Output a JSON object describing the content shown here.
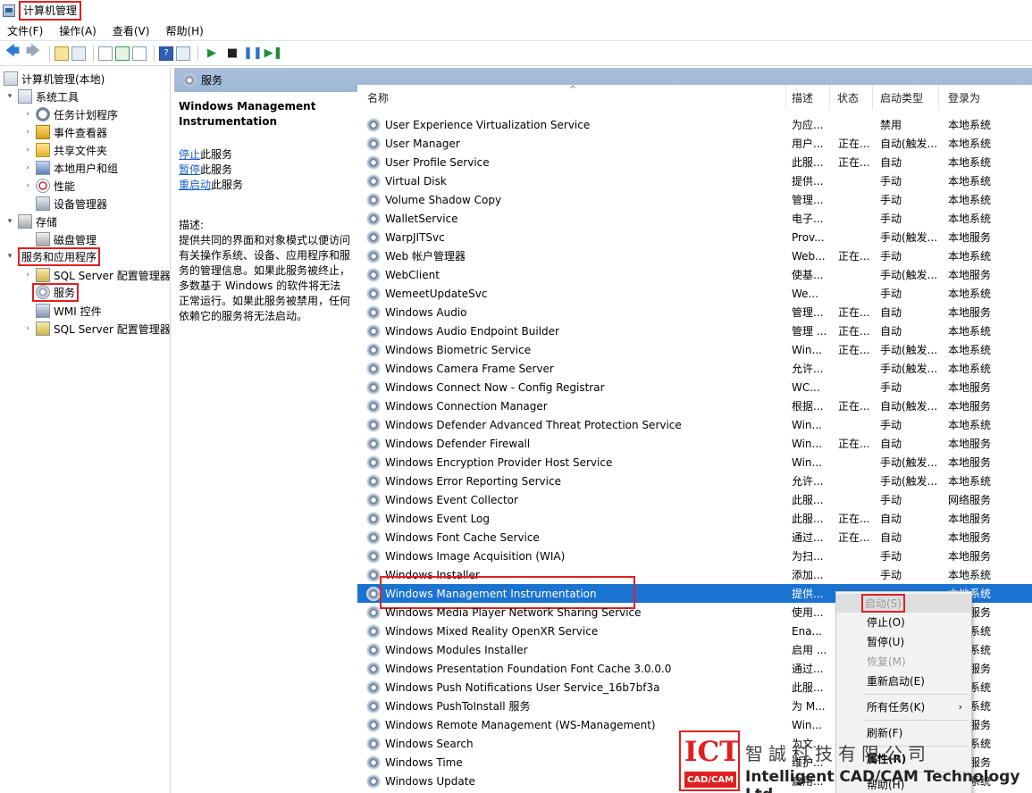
{
  "window": {
    "title": "计算机管理"
  },
  "menubar": [
    {
      "label": "文件(F)"
    },
    {
      "label": "操作(A)"
    },
    {
      "label": "查看(V)"
    },
    {
      "label": "帮助(H)"
    }
  ],
  "tree": {
    "root": "计算机管理(本地)",
    "system_tools": "系统工具",
    "task_scheduler": "任务计划程序",
    "event_viewer": "事件查看器",
    "shared_folders": "共享文件夹",
    "local_users": "本地用户和组",
    "performance": "性能",
    "device_manager": "设备管理器",
    "storage": "存储",
    "disk_management": "磁盘管理",
    "services_apps": "服务和应用程序",
    "sql_config_1": "SQL Server 配置管理器",
    "services": "服务",
    "wmi": "WMI 控件",
    "sql_config_2": "SQL Server 配置管理器"
  },
  "panel_header": "服务",
  "description": {
    "title": "Windows Management Instrumentation",
    "stop_link": "停止",
    "stop_suffix": "此服务",
    "pause_link": "暂停",
    "pause_suffix": "此服务",
    "restart_link": "重启动",
    "restart_suffix": "此服务",
    "label": "描述:",
    "body": "提供共同的界面和对象模式以便访问有关操作系统、设备、应用程序和服务的管理信息。如果此服务被终止，多数基于 Windows 的软件将无法正常运行。如果此服务被禁用，任何依赖它的服务将无法启动。"
  },
  "columns": {
    "name": "名称",
    "desc": "描述",
    "status": "状态",
    "startup": "启动类型",
    "logon": "登录为"
  },
  "services": [
    {
      "name": "User Experience Virtualization Service",
      "desc": "为应...",
      "status": "",
      "startup": "禁用",
      "logon": "本地系统"
    },
    {
      "name": "User Manager",
      "desc": "用户...",
      "status": "正在...",
      "startup": "自动(触发...",
      "logon": "本地系统"
    },
    {
      "name": "User Profile Service",
      "desc": "此服...",
      "status": "正在...",
      "startup": "自动",
      "logon": "本地系统"
    },
    {
      "name": "Virtual Disk",
      "desc": "提供...",
      "status": "",
      "startup": "手动",
      "logon": "本地系统"
    },
    {
      "name": "Volume Shadow Copy",
      "desc": "管理...",
      "status": "",
      "startup": "手动",
      "logon": "本地系统"
    },
    {
      "name": "WalletService",
      "desc": "电子...",
      "status": "",
      "startup": "手动",
      "logon": "本地系统"
    },
    {
      "name": "WarpJITSvc",
      "desc": "Prov...",
      "status": "",
      "startup": "手动(触发...",
      "logon": "本地服务"
    },
    {
      "name": "Web 帐户管理器",
      "desc": "Web...",
      "status": "正在...",
      "startup": "手动",
      "logon": "本地系统"
    },
    {
      "name": "WebClient",
      "desc": "使基...",
      "status": "",
      "startup": "手动(触发...",
      "logon": "本地服务"
    },
    {
      "name": "WemeetUpdateSvc",
      "desc": "We...",
      "status": "",
      "startup": "手动",
      "logon": "本地系统"
    },
    {
      "name": "Windows Audio",
      "desc": "管理...",
      "status": "正在...",
      "startup": "自动",
      "logon": "本地服务"
    },
    {
      "name": "Windows Audio Endpoint Builder",
      "desc": "管理 ...",
      "status": "正在...",
      "startup": "自动",
      "logon": "本地系统"
    },
    {
      "name": "Windows Biometric Service",
      "desc": "Win...",
      "status": "正在...",
      "startup": "手动(触发...",
      "logon": "本地系统"
    },
    {
      "name": "Windows Camera Frame Server",
      "desc": "允许...",
      "status": "",
      "startup": "手动(触发...",
      "logon": "本地系统"
    },
    {
      "name": "Windows Connect Now - Config Registrar",
      "desc": "WC...",
      "status": "",
      "startup": "手动",
      "logon": "本地服务"
    },
    {
      "name": "Windows Connection Manager",
      "desc": "根据...",
      "status": "正在...",
      "startup": "自动(触发...",
      "logon": "本地服务"
    },
    {
      "name": "Windows Defender Advanced Threat Protection Service",
      "desc": "Win...",
      "status": "",
      "startup": "手动",
      "logon": "本地系统"
    },
    {
      "name": "Windows Defender Firewall",
      "desc": "Win...",
      "status": "正在...",
      "startup": "自动",
      "logon": "本地服务"
    },
    {
      "name": "Windows Encryption Provider Host Service",
      "desc": "Win...",
      "status": "",
      "startup": "手动(触发...",
      "logon": "本地服务"
    },
    {
      "name": "Windows Error Reporting Service",
      "desc": "允许...",
      "status": "",
      "startup": "手动(触发...",
      "logon": "本地系统"
    },
    {
      "name": "Windows Event Collector",
      "desc": "此服...",
      "status": "",
      "startup": "手动",
      "logon": "网络服务"
    },
    {
      "name": "Windows Event Log",
      "desc": "此服...",
      "status": "正在...",
      "startup": "自动",
      "logon": "本地服务"
    },
    {
      "name": "Windows Font Cache Service",
      "desc": "通过...",
      "status": "正在...",
      "startup": "自动",
      "logon": "本地服务"
    },
    {
      "name": "Windows Image Acquisition (WIA)",
      "desc": "为扫...",
      "status": "",
      "startup": "手动",
      "logon": "本地服务"
    },
    {
      "name": "Windows Installer",
      "desc": "添加...",
      "status": "",
      "startup": "手动",
      "logon": "本地系统"
    },
    {
      "name": "Windows Management Instrumentation",
      "desc": "提供...",
      "status": "",
      "startup": "",
      "logon": "本地系统"
    },
    {
      "name": "Windows Media Player Network Sharing Service",
      "desc": "使用...",
      "status": "",
      "startup": "",
      "logon": "网络服务"
    },
    {
      "name": "Windows Mixed Reality OpenXR Service",
      "desc": "Ena...",
      "status": "",
      "startup": "",
      "logon": "本地系统"
    },
    {
      "name": "Windows Modules Installer",
      "desc": "启用 ...",
      "status": "",
      "startup": "",
      "logon": "本地系统"
    },
    {
      "name": "Windows Presentation Foundation Font Cache 3.0.0.0",
      "desc": "通过...",
      "status": "",
      "startup": "",
      "logon": "本地服务"
    },
    {
      "name": "Windows Push Notifications User Service_16b7bf3a",
      "desc": "此服...",
      "status": "",
      "startup": "",
      "logon": "本地系统"
    },
    {
      "name": "Windows PushToInstall 服务",
      "desc": "为 M...",
      "status": "",
      "startup": "",
      "logon": "本地系统"
    },
    {
      "name": "Windows Remote Management (WS-Management)",
      "desc": "Win...",
      "status": "",
      "startup": "",
      "logon": "网络服务"
    },
    {
      "name": "Windows Search",
      "desc": "为文...",
      "status": "",
      "startup": "",
      "logon": "本地系统"
    },
    {
      "name": "Windows Time",
      "desc": "维护...",
      "status": "",
      "startup": "",
      "logon": "本地服务"
    },
    {
      "name": "Windows Update",
      "desc": "启用...",
      "status": "",
      "startup": "",
      "logon": "本地系统"
    }
  ],
  "context_menu": {
    "start": "启动(S)",
    "stop": "停止(O)",
    "pause": "暂停(U)",
    "resume": "恢复(M)",
    "restart": "重新启动(E)",
    "all_tasks": "所有任务(K)",
    "refresh": "刷新(F)",
    "properties": "属性(R)",
    "help": "帮助(H)"
  },
  "watermark": {
    "logo": "ICT",
    "logo_sub": "CAD/CAM",
    "cn": "智誠科技有限公司",
    "en": "Intelligent CAD/CAM Technology Ltd."
  },
  "colors": {
    "selection": "#1a73d0",
    "highlight_box": "#e02020",
    "header_band": "#a4bbd9"
  }
}
